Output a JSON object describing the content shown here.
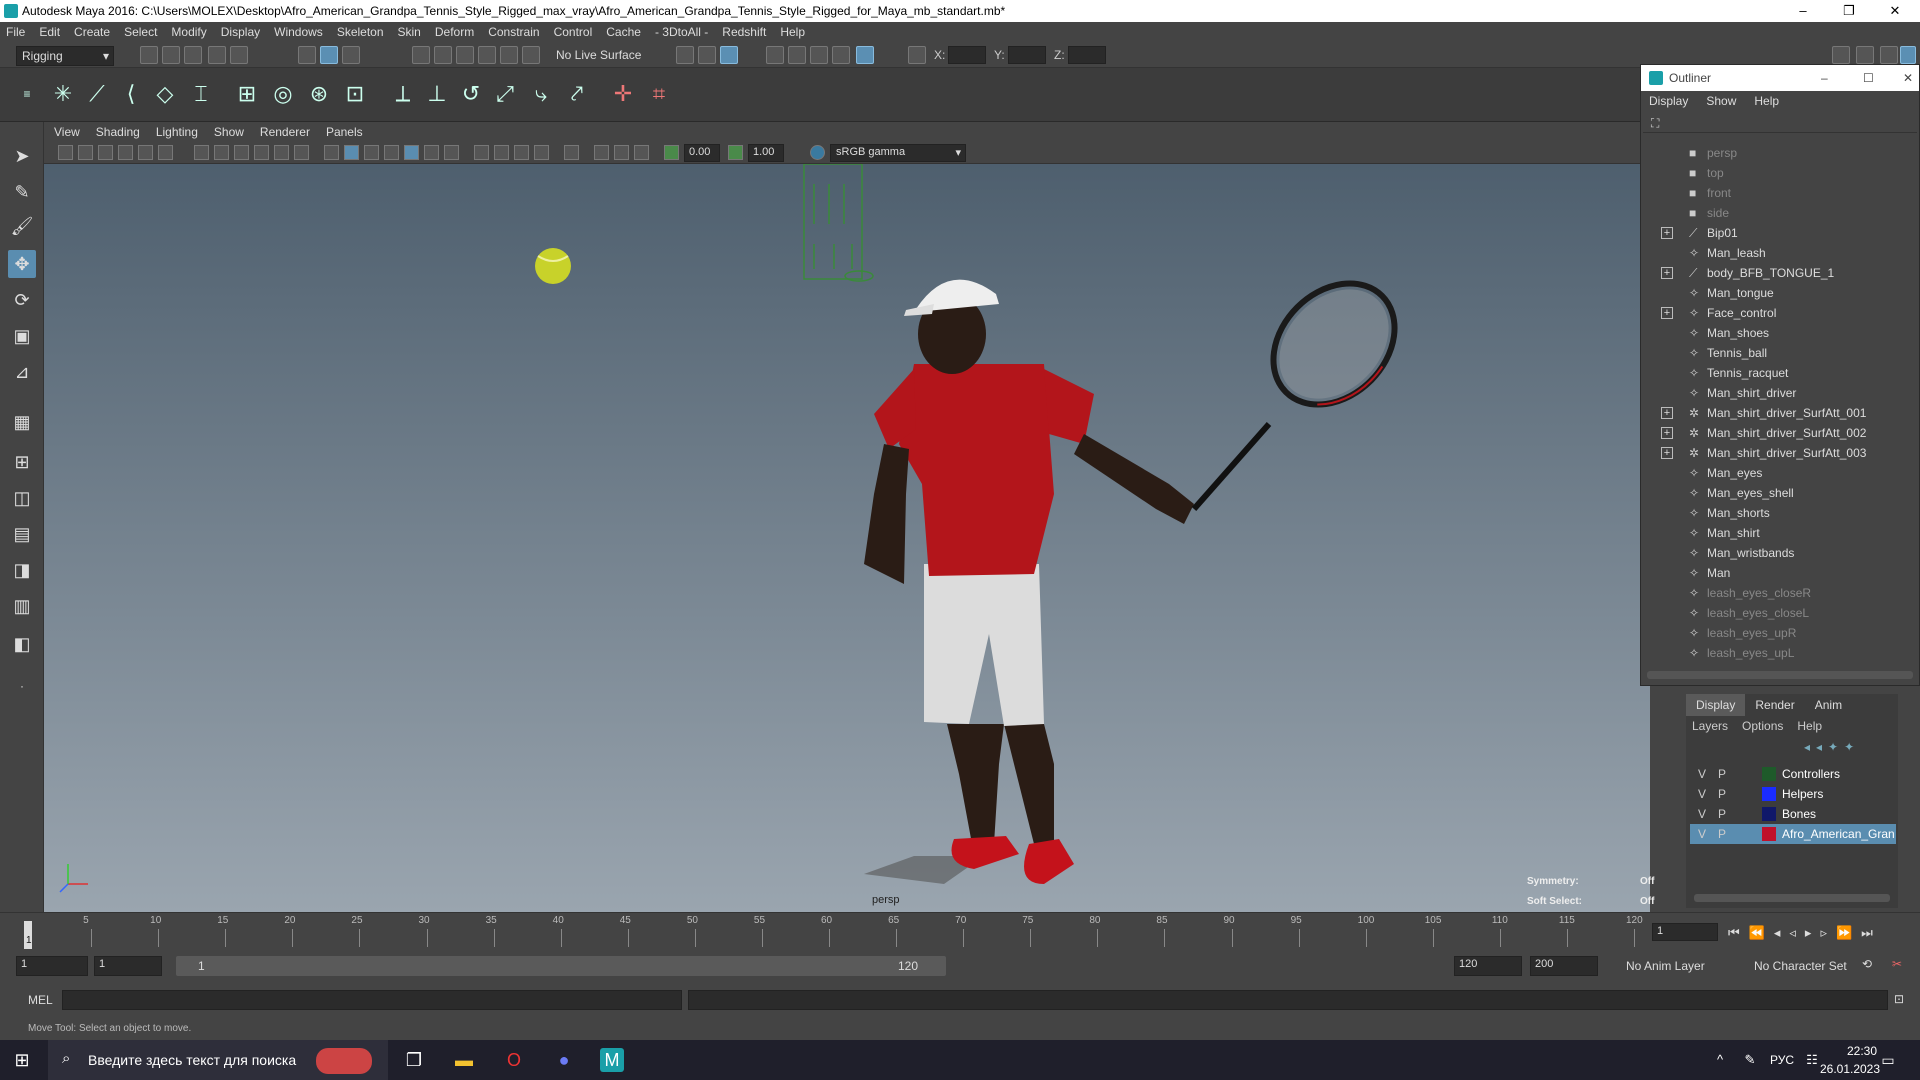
{
  "window": {
    "title": "Autodesk Maya 2016: C:\\Users\\MOLEX\\Desktop\\Afro_American_Grandpa_Tennis_Style_Rigged_max_vray\\Afro_American_Grandpa_Tennis_Style_Rigged_for_Maya_mb_standart.mb*",
    "min": "–",
    "max": "❐",
    "close": "✕"
  },
  "menubar": [
    "File",
    "Edit",
    "Create",
    "Select",
    "Modify",
    "Display",
    "Windows",
    "Skeleton",
    "Skin",
    "Deform",
    "Constrain",
    "Control",
    "Cache",
    "- 3DtoAll -",
    "Redshift",
    "Help"
  ],
  "statusline": {
    "mode": "Rigging",
    "live_surface": "No Live Surface",
    "x_label": "X:",
    "y_label": "Y:",
    "z_label": "Z:"
  },
  "viewport": {
    "menu": [
      "View",
      "Shading",
      "Lighting",
      "Show",
      "Renderer",
      "Panels"
    ],
    "field1": "0.00",
    "field2": "1.00",
    "colorspace": "sRGB gamma",
    "camera": "persp",
    "symmetry_label": "Symmetry:",
    "symmetry_value": "Off",
    "softsel_label": "Soft Select:",
    "softsel_value": "Off"
  },
  "outliner": {
    "title": "Outliner",
    "menu": [
      "Display",
      "Show",
      "Help"
    ],
    "items": [
      {
        "label": "persp",
        "expand": false,
        "dim": true,
        "icon": "camera"
      },
      {
        "label": "top",
        "expand": false,
        "dim": true,
        "icon": "camera"
      },
      {
        "label": "front",
        "expand": false,
        "dim": true,
        "icon": "camera"
      },
      {
        "label": "side",
        "expand": false,
        "dim": true,
        "icon": "camera"
      },
      {
        "label": "Bip01",
        "expand": true,
        "dim": false,
        "icon": "joint"
      },
      {
        "label": "Man_leash",
        "expand": false,
        "dim": false,
        "icon": "mesh"
      },
      {
        "label": "body_BFB_TONGUE_1",
        "expand": true,
        "dim": false,
        "icon": "joint"
      },
      {
        "label": "Man_tongue",
        "expand": false,
        "dim": false,
        "icon": "mesh"
      },
      {
        "label": "Face_control",
        "expand": true,
        "dim": false,
        "icon": "mesh"
      },
      {
        "label": "Man_shoes",
        "expand": false,
        "dim": false,
        "icon": "mesh"
      },
      {
        "label": "Tennis_ball",
        "expand": false,
        "dim": false,
        "icon": "mesh"
      },
      {
        "label": "Tennis_racquet",
        "expand": false,
        "dim": false,
        "icon": "mesh"
      },
      {
        "label": "Man_shirt_driver",
        "expand": false,
        "dim": false,
        "icon": "mesh"
      },
      {
        "label": "Man_shirt_driver_SurfAtt_001",
        "expand": true,
        "dim": false,
        "icon": "star"
      },
      {
        "label": "Man_shirt_driver_SurfAtt_002",
        "expand": true,
        "dim": false,
        "icon": "star"
      },
      {
        "label": "Man_shirt_driver_SurfAtt_003",
        "expand": true,
        "dim": false,
        "icon": "star"
      },
      {
        "label": "Man_eyes",
        "expand": false,
        "dim": false,
        "icon": "mesh"
      },
      {
        "label": "Man_eyes_shell",
        "expand": false,
        "dim": false,
        "icon": "mesh"
      },
      {
        "label": "Man_shorts",
        "expand": false,
        "dim": false,
        "icon": "mesh"
      },
      {
        "label": "Man_shirt",
        "expand": false,
        "dim": false,
        "icon": "mesh"
      },
      {
        "label": "Man_wristbands",
        "expand": false,
        "dim": false,
        "icon": "mesh"
      },
      {
        "label": "Man",
        "expand": false,
        "dim": false,
        "icon": "mesh"
      },
      {
        "label": "leash_eyes_closeR",
        "expand": false,
        "dim": true,
        "icon": "mesh"
      },
      {
        "label": "leash_eyes_closeL",
        "expand": false,
        "dim": true,
        "icon": "mesh"
      },
      {
        "label": "leash_eyes_upR",
        "expand": false,
        "dim": true,
        "icon": "mesh"
      },
      {
        "label": "leash_eyes_upL",
        "expand": false,
        "dim": true,
        "icon": "mesh"
      }
    ]
  },
  "layers": {
    "tabs": [
      "Display",
      "Render",
      "Anim"
    ],
    "menu": [
      "Layers",
      "Options",
      "Help"
    ],
    "rows": [
      {
        "v": "V",
        "p": "P",
        "color": "#1e5a2a",
        "name": "Controllers",
        "selected": false
      },
      {
        "v": "V",
        "p": "P",
        "color": "#1a2cff",
        "name": "Helpers",
        "selected": false
      },
      {
        "v": "V",
        "p": "P",
        "color": "#10186a",
        "name": "Bones",
        "selected": false
      },
      {
        "v": "V",
        "p": "P",
        "color": "#c0102a",
        "name": "Afro_American_Grandp",
        "selected": true
      }
    ]
  },
  "timeline": {
    "ticks": [
      "5",
      "10",
      "15",
      "20",
      "25",
      "30",
      "35",
      "40",
      "45",
      "50",
      "55",
      "60",
      "65",
      "70",
      "75",
      "80",
      "85",
      "90",
      "95",
      "100",
      "105",
      "110",
      "115",
      "120"
    ],
    "current": "1",
    "current_field": "1"
  },
  "range": {
    "start": "1",
    "start2": "1",
    "slider_start": "1",
    "slider_end": "120",
    "end": "120",
    "end2": "200",
    "anim_layer": "No Anim Layer",
    "char_set": "No Character Set"
  },
  "cmd": {
    "label": "MEL"
  },
  "help": {
    "text": "Move Tool: Select an object to move."
  },
  "taskbar": {
    "search": "Введите здесь текст для поиска",
    "lang": "РУС",
    "time": "22:30",
    "date": "26.01.2023"
  },
  "colors": {
    "accent": "#5a8db0",
    "ball": "#c8d22a",
    "shirt": "#b3151b"
  }
}
